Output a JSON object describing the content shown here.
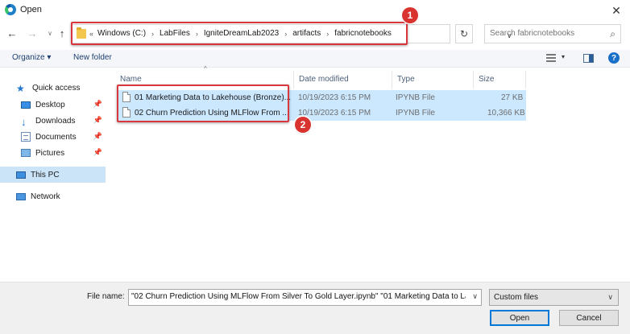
{
  "window": {
    "title": "Open",
    "close_glyph": "✕"
  },
  "nav": {
    "back_glyph": "←",
    "forward_glyph": "→",
    "recent_glyph": "∨",
    "up_glyph": "↑",
    "breadcrumb_lead": "«",
    "breadcrumbs": [
      "Windows (C:)",
      "LabFiles",
      "IgniteDreamLab2023",
      "artifacts",
      "fabricnotebooks"
    ],
    "crumb_separator": "›",
    "dropdown_glyph": "∨",
    "refresh_glyph": "↻",
    "search_placeholder": "Search fabricnotebooks",
    "search_glyph": "⌕"
  },
  "toolbar": {
    "organize_label": "Organize ▾",
    "new_folder_label": "New folder",
    "view_caret": "▾",
    "help_glyph": "?"
  },
  "sidebar": {
    "items": [
      {
        "label": "Quick access",
        "icon": "star-icon",
        "glyph": "★",
        "pinned": false
      },
      {
        "label": "Desktop",
        "icon": "desktop-icon",
        "pinned": true
      },
      {
        "label": "Downloads",
        "icon": "download-icon",
        "glyph": "↓",
        "pinned": true
      },
      {
        "label": "Documents",
        "icon": "document-icon",
        "pinned": true
      },
      {
        "label": "Pictures",
        "icon": "pictures-icon",
        "pinned": true
      },
      {
        "label": "This PC",
        "icon": "computer-icon",
        "selected": true
      },
      {
        "label": "Network",
        "icon": "network-icon"
      }
    ],
    "pin_glyph": "📌"
  },
  "columns": {
    "name": "Name",
    "date": "Date modified",
    "type": "Type",
    "size": "Size",
    "sort_glyph": "^"
  },
  "files": [
    {
      "name": "01 Marketing Data to Lakehouse (Bronze)...",
      "date": "10/19/2023 6:15 PM",
      "type": "IPYNB File",
      "size": "27 KB"
    },
    {
      "name": "02 Churn Prediction Using MLFlow From ...",
      "date": "10/19/2023 6:15 PM",
      "type": "IPYNB File",
      "size": "10,366 KB"
    }
  ],
  "callouts": [
    "1",
    "2"
  ],
  "footer": {
    "file_name_label": "File name:",
    "file_name_value": "\"02 Churn Prediction Using MLFlow From Silver To Gold Layer.ipynb\" \"01 Marketing Data to La",
    "file_type_value": "Custom files",
    "caret_glyph": "∨",
    "open_label": "Open",
    "cancel_label": "Cancel"
  },
  "colors": {
    "accent": "#0078d7",
    "callout": "#d8332f",
    "selection": "#cce8ff"
  }
}
